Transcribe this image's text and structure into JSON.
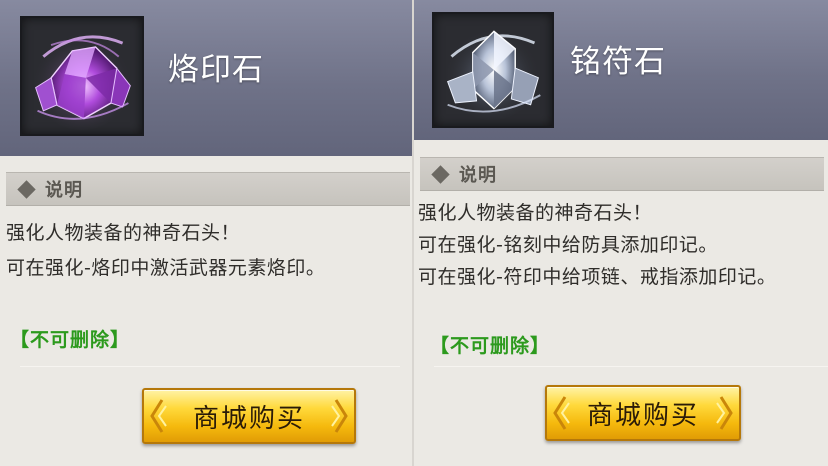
{
  "panels": [
    {
      "item_name": "烙印石",
      "icon": "purple-crystal-icon",
      "section_title": "说明",
      "description": [
        "强化人物装备的神奇石头！",
        "可在强化-烙印中激活武器元素烙印。"
      ],
      "tag": "【不可删除】",
      "buy_button": "商城购买"
    },
    {
      "item_name": "铭符石",
      "icon": "silver-crystal-icon",
      "section_title": "说明",
      "description": [
        "强化人物装备的神奇石头！",
        "可在强化-铭刻中给防具添加印记。",
        "可在强化-符印中给项链、戒指添加印记。"
      ],
      "tag": "【不可删除】",
      "buy_button": "商城购买"
    }
  ],
  "colors": {
    "header": "#6f7288",
    "body": "#ebe9e4",
    "tag_green": "#2c9a1d",
    "button_gold": "#f5b90d"
  }
}
